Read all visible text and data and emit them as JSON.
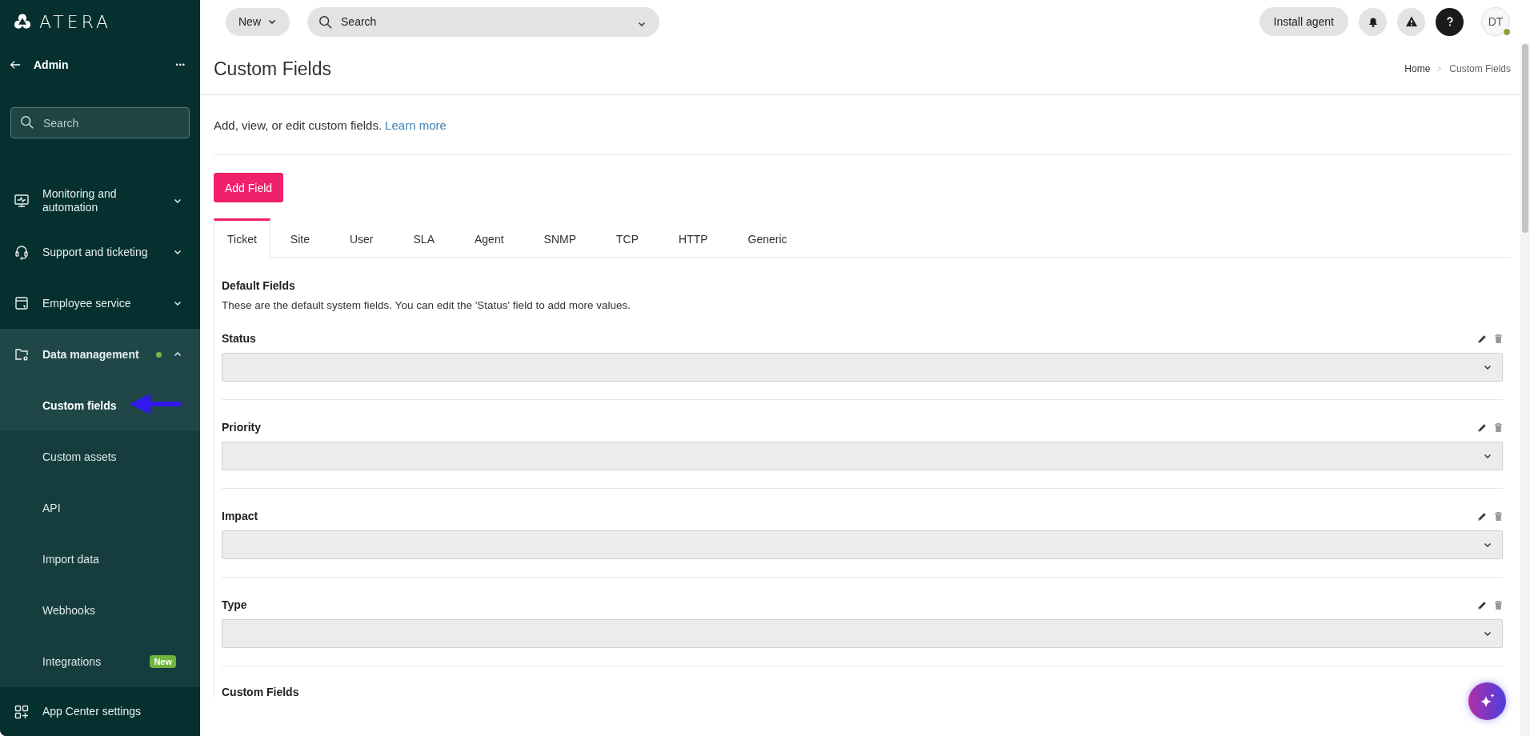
{
  "sidebar": {
    "brand": "ATERA",
    "back": {
      "label": "Admin",
      "more": "•••"
    },
    "search": {
      "placeholder": "Search"
    },
    "items": [
      {
        "kind": "group",
        "label": "Monitoring and automation",
        "expanded": false,
        "dot": false
      },
      {
        "kind": "group",
        "label": "Support and ticketing",
        "expanded": false,
        "dot": false
      },
      {
        "kind": "group",
        "label": "Employee service",
        "expanded": false,
        "dot": false
      },
      {
        "kind": "group",
        "label": "Data management",
        "expanded": true,
        "dot": true,
        "children": [
          {
            "label": "Custom fields",
            "selected": true
          },
          {
            "label": "Custom assets",
            "selected": false
          },
          {
            "label": "API",
            "selected": false
          },
          {
            "label": "Import data",
            "selected": false
          },
          {
            "label": "Webhooks",
            "selected": false
          },
          {
            "label": "Integrations",
            "selected": false,
            "badge": "New"
          }
        ]
      },
      {
        "kind": "link",
        "label": "App Center settings"
      }
    ]
  },
  "topbar": {
    "new_button": "New",
    "search": {
      "placeholder": "Search"
    },
    "install_button": "Install agent",
    "avatar": {
      "initials": "DT",
      "online": true
    }
  },
  "page": {
    "title": "Custom Fields",
    "breadcrumb": [
      "Home",
      "Custom Fields"
    ],
    "intro": "Add, view, or edit custom fields.",
    "learn_more": "Learn more",
    "add_button": "Add Field",
    "tabs": [
      {
        "label": "Ticket",
        "selected": true
      },
      {
        "label": "Site",
        "selected": false
      },
      {
        "label": "User",
        "selected": false
      },
      {
        "label": "SLA",
        "selected": false
      },
      {
        "label": "Agent",
        "selected": false
      },
      {
        "label": "SNMP",
        "selected": false
      },
      {
        "label": "TCP",
        "selected": false
      },
      {
        "label": "HTTP",
        "selected": false
      },
      {
        "label": "Generic",
        "selected": false
      }
    ],
    "default_section": {
      "title": "Default Fields",
      "description": "These are the default system fields. You can edit the 'Status' field to add more values.",
      "fields": [
        {
          "label": "Status",
          "delete_enabled": false
        },
        {
          "label": "Priority",
          "delete_enabled": false
        },
        {
          "label": "Impact",
          "delete_enabled": false
        },
        {
          "label": "Type",
          "delete_enabled": false
        }
      ]
    },
    "custom_section": {
      "title": "Custom Fields"
    }
  }
}
